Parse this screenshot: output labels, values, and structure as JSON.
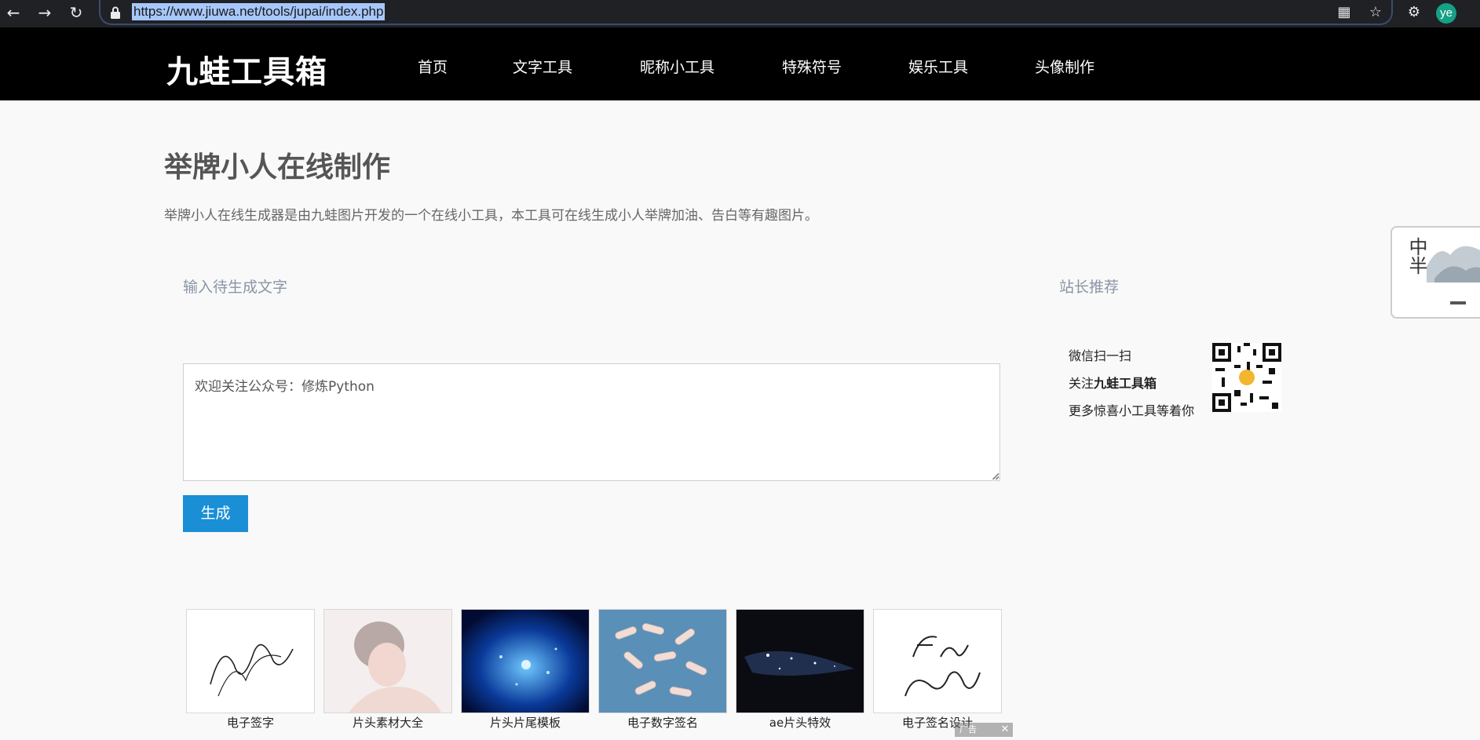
{
  "browser": {
    "url": "https://www.jiuwa.net/tools/jupai/index.php",
    "avatar_text": "ye",
    "icons": [
      "back-icon",
      "forward-icon",
      "reload-icon",
      "lock-icon",
      "grid-icon",
      "star-icon",
      "extensions-icon"
    ]
  },
  "header": {
    "logo": "九蛙工具箱",
    "nav": [
      "首页",
      "文字工具",
      "昵称小工具",
      "特殊符号",
      "娱乐工具",
      "头像制作"
    ]
  },
  "main": {
    "title": "举牌小人在线制作",
    "description": "举牌小人在线生成器是由九蛙图片开发的一个在线小工具，本工具可在线生成小人举牌加油、告白等有趣图片。",
    "input_label": "输入待生成文字",
    "textarea_value": "欢迎关注公众号：修炼Python",
    "generate_button": "生成"
  },
  "sidebar": {
    "heading": "站长推荐",
    "qr_line1": "微信扫一扫",
    "qr_line2_prefix": "关注",
    "qr_line2_bold": "九蛙工具箱",
    "qr_line3": "更多惊喜小工具等着你"
  },
  "float": {
    "calligraphy": "中半"
  },
  "thumbnails": [
    {
      "label": "电子签字"
    },
    {
      "label": "片头素材大全"
    },
    {
      "label": "片头片尾模板"
    },
    {
      "label": "电子数字签名"
    },
    {
      "label": "ae片头特效"
    },
    {
      "label": "电子签名设计"
    }
  ],
  "ad": {
    "tag": "广告"
  },
  "colors": {
    "accent": "#1a8fd6",
    "header_bg": "#000000",
    "page_bg": "#f9f9f9"
  }
}
